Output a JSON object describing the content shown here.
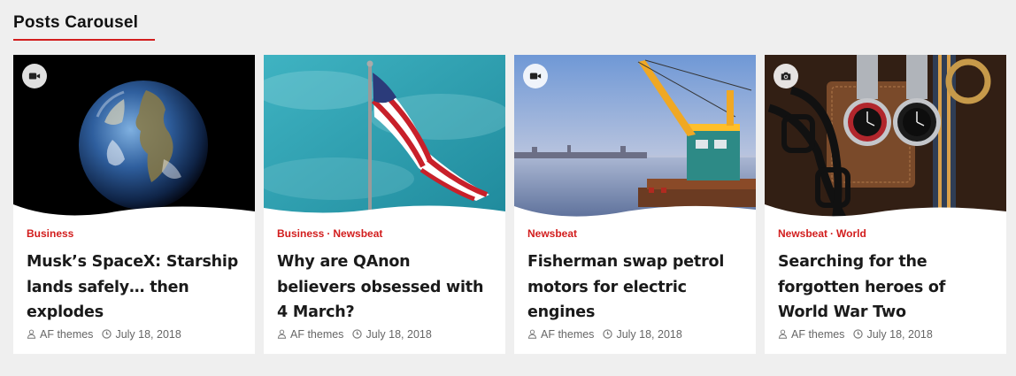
{
  "section": {
    "title": "Posts Carousel"
  },
  "colors": {
    "accent": "#d21d1d",
    "background": "#efefef",
    "card": "#ffffff"
  },
  "cards": [
    {
      "format_icon": "video-icon",
      "categories": [
        "Business"
      ],
      "title": "Musk’s SpaceX: Starship lands safely… then explodes",
      "author": "AF themes",
      "date": "July 18, 2018"
    },
    {
      "format_icon": "",
      "categories": [
        "Business",
        "Newsbeat"
      ],
      "title": "Why are QAnon believers obsessed with 4 March?",
      "author": "AF themes",
      "date": "July 18, 2018"
    },
    {
      "format_icon": "video-icon",
      "categories": [
        "Newsbeat"
      ],
      "title": "Fisherman swap petrol motors for electric engines",
      "author": "AF themes",
      "date": "July 18, 2018"
    },
    {
      "format_icon": "camera-icon",
      "categories": [
        "Newsbeat",
        "World"
      ],
      "title": "Searching for the forgotten heroes of World War Two",
      "author": "AF themes",
      "date": "July 18, 2018"
    }
  ]
}
